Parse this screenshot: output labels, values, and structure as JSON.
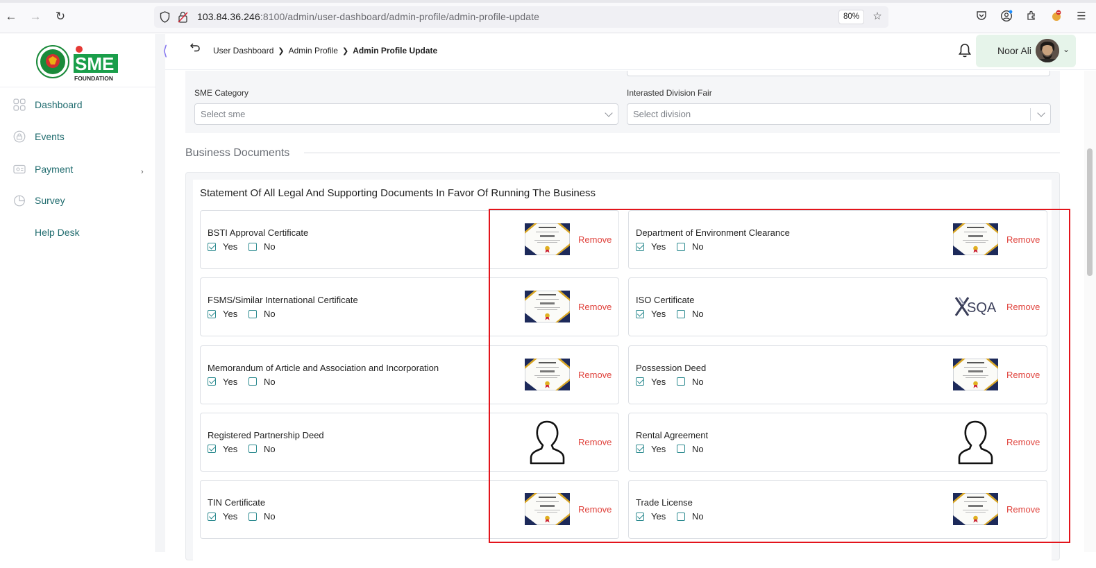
{
  "browser": {
    "url_host": "103.84.36.246",
    "url_rest": ":8100/admin/user-dashboard/admin-profile/admin-profile-update",
    "zoom": "80%"
  },
  "sidebar": {
    "logo_text": "FOUNDATION",
    "logo_letters": "SME",
    "items": [
      {
        "label": "Dashboard",
        "icon": "grid-icon"
      },
      {
        "label": "Events",
        "icon": "lock-icon"
      },
      {
        "label": "Payment",
        "icon": "card-icon"
      },
      {
        "label": "Survey",
        "icon": "pie-chart-icon"
      },
      {
        "label": "Help Desk",
        "icon": ""
      }
    ]
  },
  "header": {
    "breadcrumb": [
      "User Dashboard",
      "Admin Profile",
      "Admin Profile Update"
    ],
    "user_name": "Noor Ali"
  },
  "form": {
    "sme_category_label": "SME Category",
    "sme_category_placeholder": "Select sme",
    "division_label": "Interasted Division Fair",
    "division_placeholder": "Select division"
  },
  "documents": {
    "section_title": "Business Documents",
    "heading": "Statement Of All Legal And Supporting Documents In Favor Of Running The Business",
    "yes_label": "Yes",
    "no_label": "No",
    "remove_label": "Remove",
    "items": [
      {
        "title": "BSTI Approval Certificate",
        "yes": true,
        "no": false,
        "thumb": "certificate"
      },
      {
        "title": "Department of Environment Clearance",
        "yes": true,
        "no": false,
        "thumb": "certificate"
      },
      {
        "title": "FSMS/Similar International Certificate",
        "yes": true,
        "no": false,
        "thumb": "certificate"
      },
      {
        "title": "ISO Certificate",
        "yes": true,
        "no": false,
        "thumb": "sqa-logo",
        "thumb_text": "SQA"
      },
      {
        "title": "Memorandum of Article and Association and Incorporation",
        "yes": true,
        "no": false,
        "thumb": "certificate"
      },
      {
        "title": "Possession Deed",
        "yes": true,
        "no": false,
        "thumb": "certificate"
      },
      {
        "title": "Registered Partnership Deed",
        "yes": true,
        "no": false,
        "thumb": "person"
      },
      {
        "title": "Rental Agreement",
        "yes": true,
        "no": false,
        "thumb": "person"
      },
      {
        "title": "TIN Certificate",
        "yes": true,
        "no": false,
        "thumb": "certificate"
      },
      {
        "title": "Trade License",
        "yes": true,
        "no": false,
        "thumb": "certificate"
      }
    ]
  },
  "colors": {
    "accent_teal": "#1f6b6e",
    "remove_red": "#e0443e",
    "highlight_red": "#e3141b",
    "user_box_bg": "#e6f4ea"
  }
}
